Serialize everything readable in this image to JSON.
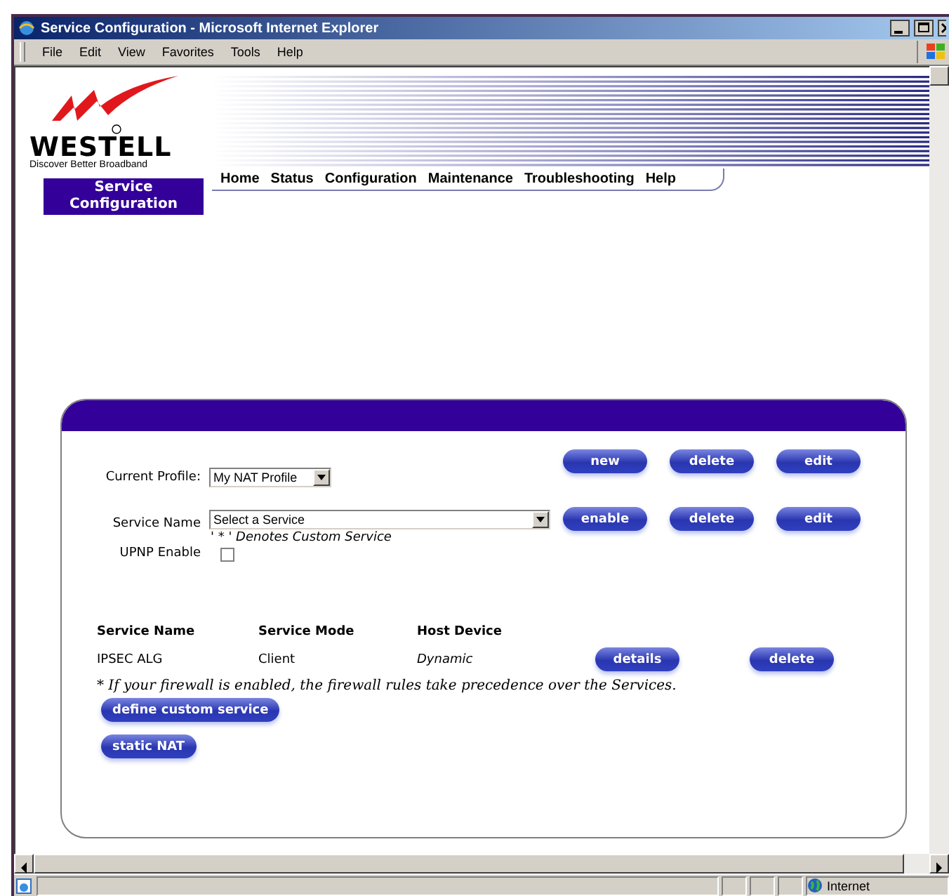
{
  "window": {
    "title": "Service Configuration - Microsoft Internet Explorer"
  },
  "menu": [
    "File",
    "Edit",
    "View",
    "Favorites",
    "Tools",
    "Help"
  ],
  "logo": {
    "name": "WESTELL",
    "tagline": "Discover Better Broadband"
  },
  "nav": [
    "Home",
    "Status",
    "Configuration",
    "Maintenance",
    "Troubleshooting",
    "Help"
  ],
  "page_label": "Service Configuration",
  "profile": {
    "label": "Current Profile:",
    "value": "My NAT Profile",
    "buttons": [
      "new",
      "delete",
      "edit"
    ]
  },
  "service": {
    "label": "Service Name",
    "value": "Select a Service",
    "note": "' * ' Denotes Custom Service",
    "buttons": [
      "enable",
      "delete",
      "edit"
    ]
  },
  "upnp": {
    "label": "UPNP Enable",
    "checked": false
  },
  "table": {
    "columns": [
      "Service Name",
      "Service Mode",
      "Host Device"
    ],
    "rows": [
      {
        "service_name": "IPSEC ALG",
        "service_mode": "Client",
        "host_device": "Dynamic",
        "buttons": [
          "details",
          "delete"
        ]
      }
    ]
  },
  "footnote": "* If your firewall is enabled, the firewall rules take precedence over the Services.",
  "buttons": [
    "define custom service",
    "static NAT"
  ],
  "status_bar": {
    "zone": "Internet"
  }
}
